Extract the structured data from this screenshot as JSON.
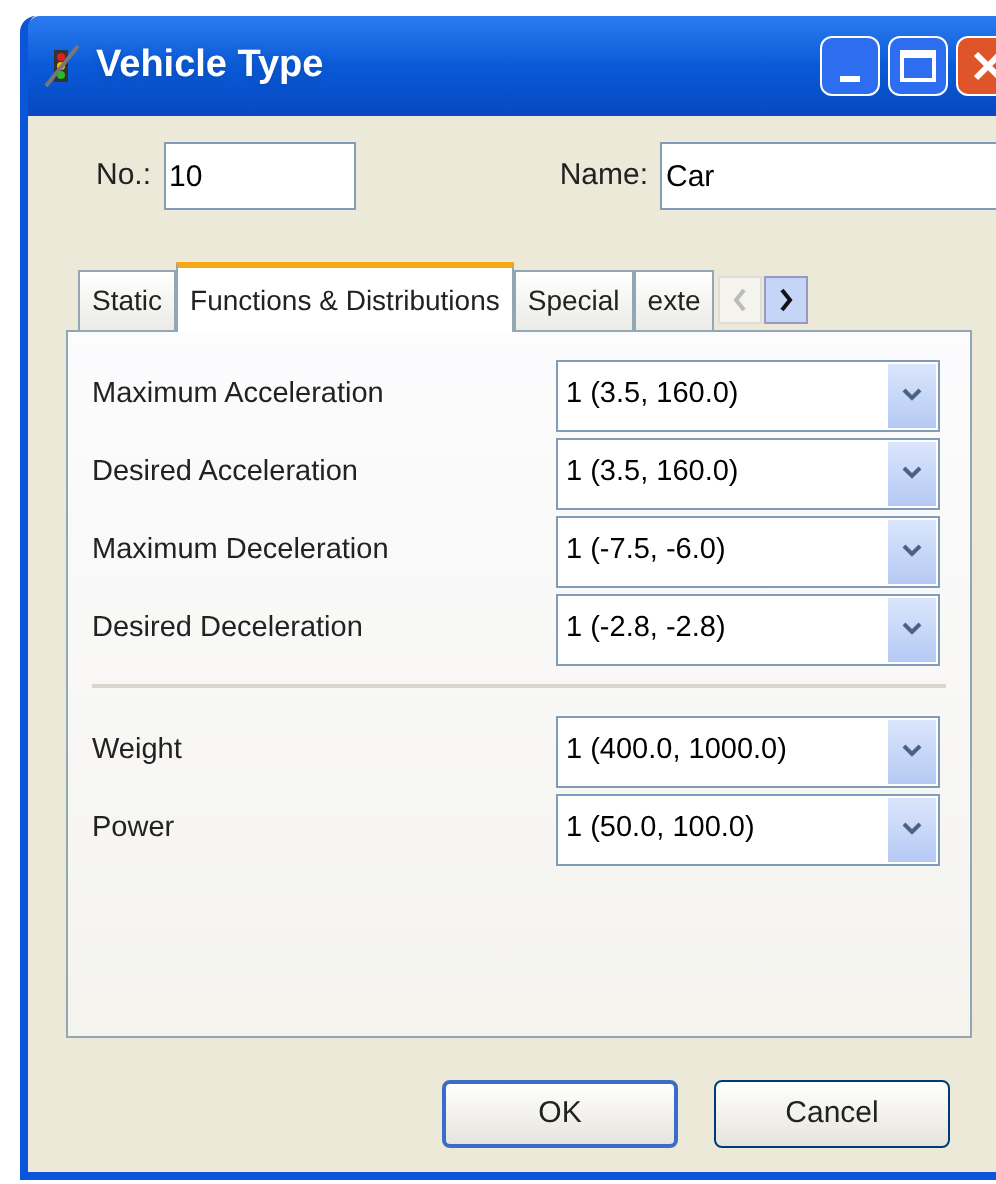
{
  "window": {
    "title": "Vehicle Type"
  },
  "fields": [
    {
      "label": "No.:",
      "value": "10"
    },
    {
      "label": "Name:",
      "value": "Car"
    }
  ],
  "tabs": [
    {
      "label": "Static",
      "selected": false
    },
    {
      "label": "Functions & Distributions",
      "selected": true
    },
    {
      "label": "Special",
      "selected": false
    },
    {
      "label": "exte",
      "selected": false
    }
  ],
  "sections": [
    {
      "rows": [
        {
          "label": "Maximum Acceleration",
          "value": "1 (3.5, 160.0)"
        },
        {
          "label": "Desired Acceleration",
          "value": "1 (3.5, 160.0)"
        },
        {
          "label": "Maximum Deceleration",
          "value": "1 (-7.5, -6.0)"
        },
        {
          "label": "Desired Deceleration",
          "value": "1 (-2.8, -2.8)"
        }
      ]
    },
    {
      "rows": [
        {
          "label": "Weight",
          "value": "1 (400.0, 1000.0)"
        },
        {
          "label": "Power",
          "value": "1 (50.0, 100.0)"
        }
      ]
    }
  ],
  "buttons": [
    {
      "label": "OK",
      "kind": "default"
    },
    {
      "label": "Cancel",
      "kind": "normal"
    }
  ]
}
